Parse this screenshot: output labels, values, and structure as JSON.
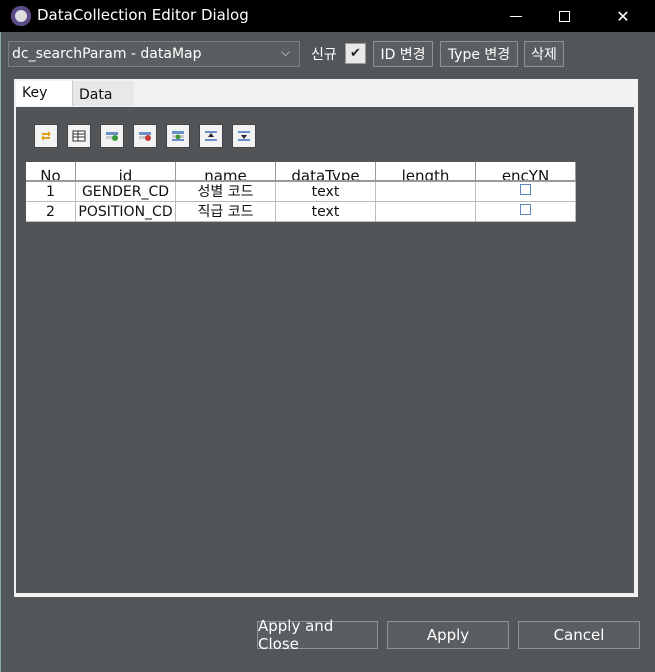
{
  "window": {
    "title": "DataCollection Editor Dialog"
  },
  "top": {
    "combo_value": "dc_searchParam - dataMap",
    "new_label": "신규",
    "id_change": "ID 변경",
    "type_change": "Type 변경",
    "delete": "삭제"
  },
  "tabs": [
    {
      "label": "Key"
    },
    {
      "label": "Data"
    }
  ],
  "toolbar": [
    {
      "icon": "refresh-icon"
    },
    {
      "icon": "view-table-icon"
    },
    {
      "icon": "add-row-icon"
    },
    {
      "icon": "delete-row-icon"
    },
    {
      "icon": "insert-row-icon"
    },
    {
      "icon": "move-up-icon"
    },
    {
      "icon": "move-down-icon"
    }
  ],
  "table": {
    "headers": [
      "No",
      "id",
      "name",
      "dataType",
      "length",
      "encYN"
    ],
    "rows": [
      {
        "no": "1",
        "id": "GENDER_CD",
        "name": "성별 코드",
        "dataType": "text",
        "length": "",
        "encYN": false
      },
      {
        "no": "2",
        "id": "POSITION_CD",
        "name": "직급 코드",
        "dataType": "text",
        "length": "",
        "encYN": false
      }
    ]
  },
  "footer": {
    "apply_close": "Apply and Close",
    "apply": "Apply",
    "cancel": "Cancel"
  }
}
